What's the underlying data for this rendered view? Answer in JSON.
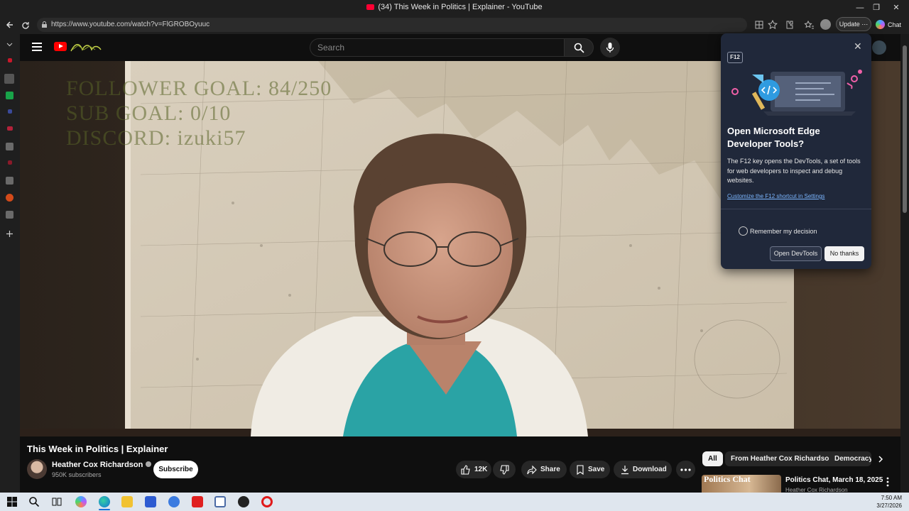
{
  "browser": {
    "tab_title": "(34) This Week in Politics | Explainer - YouTube",
    "url": "https://www.youtube.com/watch?v=FlGROBOyuuc",
    "update_label": "Update",
    "chat_label": "Chat"
  },
  "youtube": {
    "search_placeholder": "Search",
    "video": {
      "overlay_lines": [
        "FOLLOWER GOAL:  84/250",
        "SUB GOAL: 0/10",
        "DISCORD: izuki57"
      ],
      "title": "This Week in Politics | Explainer"
    },
    "channel": {
      "name": "Heather Cox Richardson",
      "subscribers": "950K subscribers",
      "subscribe_label": "Subscribe"
    },
    "actions": {
      "like_count": "12K",
      "share_label": "Share",
      "save_label": "Save",
      "download_label": "Download"
    },
    "chips": [
      "All",
      "From Heather Cox Richardson",
      "Democracy"
    ],
    "next_video": {
      "title": "Politics Chat, March 18, 2025",
      "channel": "Heather Cox Richardson",
      "thumb_text": "Politics Chat"
    }
  },
  "devtools_popup": {
    "key_badge": "F12",
    "heading": "Open Microsoft Edge Developer Tools?",
    "description": "The F12 key opens the DevTools, a set of tools for web developers to inspect and debug websites.",
    "link": "Customize the F12 shortcut in Settings",
    "remember_label": "Remember my decision",
    "open_label": "Open DevTools",
    "decline_label": "No thanks"
  },
  "taskbar": {
    "time": "7:50 AM",
    "date": "3/27/2026"
  }
}
